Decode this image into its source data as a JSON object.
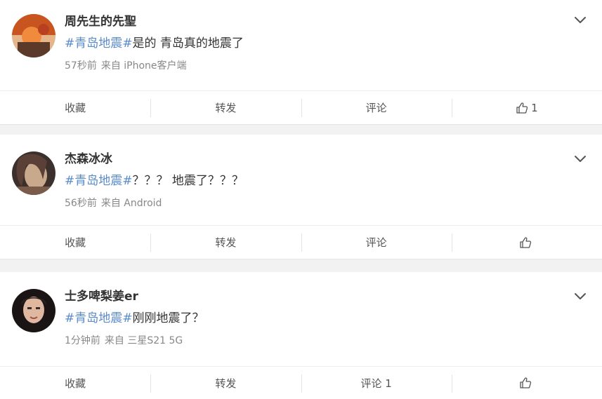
{
  "posts": [
    {
      "user": "周先生的先聖",
      "hashtag": "#青岛地震#",
      "text": "是的 青岛真的地震了",
      "time": "57秒前",
      "source": "来自 iPhone客户端",
      "avatar_colors": [
        "#c8541f",
        "#f08a3c",
        "#5c3a2a"
      ],
      "actions": {
        "favorite": "收藏",
        "repost": "转发",
        "comment": "评论",
        "like_count": "1"
      }
    },
    {
      "user": "杰森冰冰",
      "hashtag": "#青岛地震#",
      "text": "？？？ 地震了？？？",
      "time": "56秒前",
      "source": "来自 Android",
      "avatar_colors": [
        "#3b302c",
        "#c9a98c",
        "#7a5a48"
      ],
      "actions": {
        "favorite": "收藏",
        "repost": "转发",
        "comment": "评论",
        "like_count": ""
      }
    },
    {
      "user": "士多啤梨姜er",
      "hashtag": "#青岛地震#",
      "text": "刚刚地震了？",
      "time": "1分钟前",
      "source": "来自 三星S21 5G",
      "avatar_colors": [
        "#1a1414",
        "#e0b8a0",
        "#2a2020"
      ],
      "actions": {
        "favorite": "收藏",
        "repost": "转发",
        "comment": "评论 1",
        "like_count": ""
      }
    }
  ],
  "colors": {
    "hashtag": "#5a8bc9",
    "meta": "#888888",
    "divider": "#e4e4e4"
  },
  "icons": {
    "menu": "chevron-down-icon",
    "like": "thumbs-up-icon"
  }
}
